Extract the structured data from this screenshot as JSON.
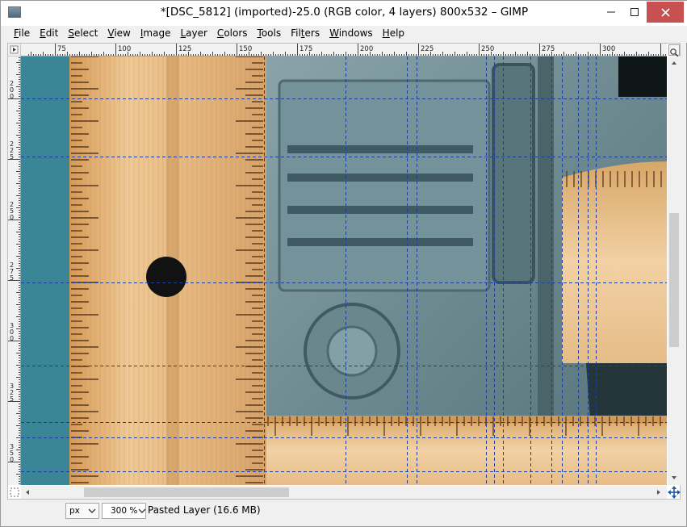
{
  "window": {
    "title": "*[DSC_5812] (imported)-25.0 (RGB color, 4 layers) 800x532 – GIMP"
  },
  "menubar": {
    "items": [
      {
        "label": "File",
        "mnemonic_index": 0
      },
      {
        "label": "Edit",
        "mnemonic_index": 0
      },
      {
        "label": "Select",
        "mnemonic_index": 0
      },
      {
        "label": "View",
        "mnemonic_index": 0
      },
      {
        "label": "Image",
        "mnemonic_index": 0
      },
      {
        "label": "Layer",
        "mnemonic_index": 0
      },
      {
        "label": "Colors",
        "mnemonic_index": 0
      },
      {
        "label": "Tools",
        "mnemonic_index": 0
      },
      {
        "label": "Filters",
        "mnemonic_index": 3
      },
      {
        "label": "Windows",
        "mnemonic_index": 0
      },
      {
        "label": "Help",
        "mnemonic_index": 0
      }
    ]
  },
  "rulers": {
    "horizontal_labels": [
      "75",
      "100",
      "125",
      "150",
      "175",
      "200",
      "225",
      "250",
      "275",
      "300"
    ],
    "vertical_labels": [
      "200",
      "225",
      "250",
      "275",
      "300",
      "325",
      "350"
    ]
  },
  "guides": {
    "horizontal": [
      52,
      124,
      280,
      383,
      453,
      472,
      514
    ],
    "vertical": [
      301,
      402,
      478,
      490,
      576,
      586,
      597,
      631,
      657,
      670,
      690,
      702,
      712
    ]
  },
  "statusbar": {
    "unit": "px",
    "zoom": "300 %",
    "message": "Pasted Layer (16.6 MB)"
  },
  "colors": {
    "title_bg": "#ffffff",
    "close_button": "#c75050",
    "chrome": "#f0f0f0",
    "guide": "#1a3fa0",
    "teal_background": "#3e8a99",
    "wood": "#e4b37a",
    "metal": "#6c8890"
  },
  "icons": {
    "app": "gimp-image-icon",
    "minimize": "minimize-icon",
    "maximize": "maximize-icon",
    "close": "close-icon",
    "menu_arrow": "ruler-menu-arrow-icon",
    "zoom": "zoom-fit-icon",
    "navigate": "navigate-icon",
    "quick_mask": "quick-mask-icon"
  }
}
